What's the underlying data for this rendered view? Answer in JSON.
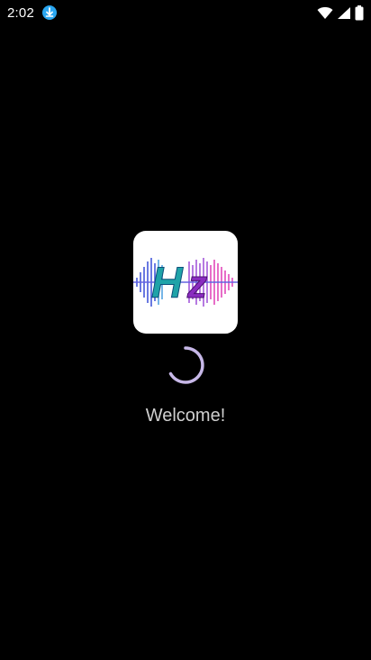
{
  "status_bar": {
    "time": "2:02",
    "icons": [
      "download-notification-icon",
      "wifi-icon",
      "cell-signal-icon",
      "battery-icon"
    ]
  },
  "splash": {
    "logo_text_h": "H",
    "logo_text_z": "z",
    "welcome_text": "Welcome!",
    "spinner_color": "#c7b8e8"
  },
  "colors": {
    "background": "#000000",
    "logo_bg": "#ffffff",
    "logo_h": "#1fa3a8",
    "logo_z": "#8a2cc0",
    "download_badge": "#2aa6f0"
  }
}
